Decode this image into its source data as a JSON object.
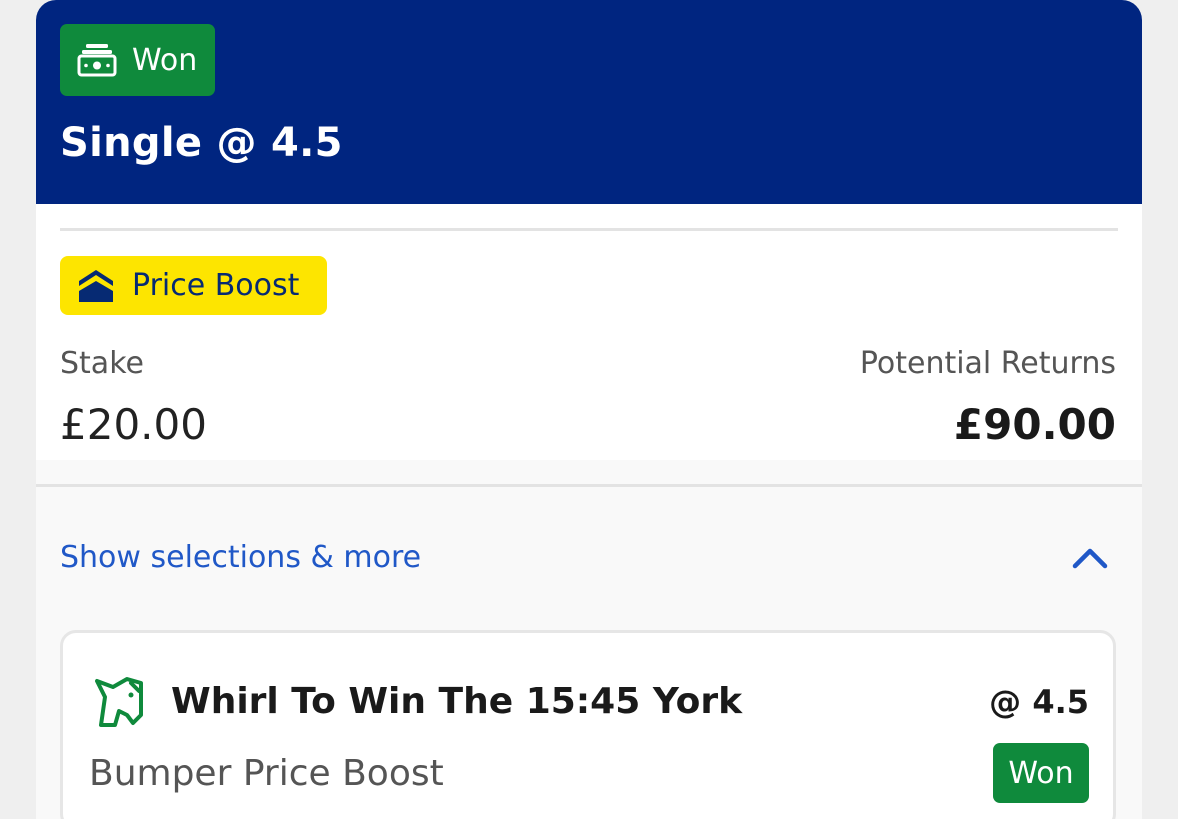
{
  "bet": {
    "status": "Won",
    "title": "Single @ 4.5",
    "promo_tag": "Price Boost",
    "stake_label": "Stake",
    "stake_value": "£20.00",
    "returns_label": "Potential Returns",
    "returns_value": "£90.00",
    "show_selections_label": "Show selections & more"
  },
  "selection": {
    "title": "Whirl To Win The 15:45 York",
    "odds": "@ 4.5",
    "market": "Bumper Price Boost",
    "status": "Won"
  },
  "colors": {
    "header_bg": "#002580",
    "won_green": "#0f8a3c",
    "boost_yellow": "#fde500",
    "link_blue": "#2058c7"
  },
  "icons": {
    "status": "cash-icon",
    "promo": "price-boost-icon",
    "toggle": "chevron-up-icon",
    "sport": "horse-racing-icon"
  }
}
